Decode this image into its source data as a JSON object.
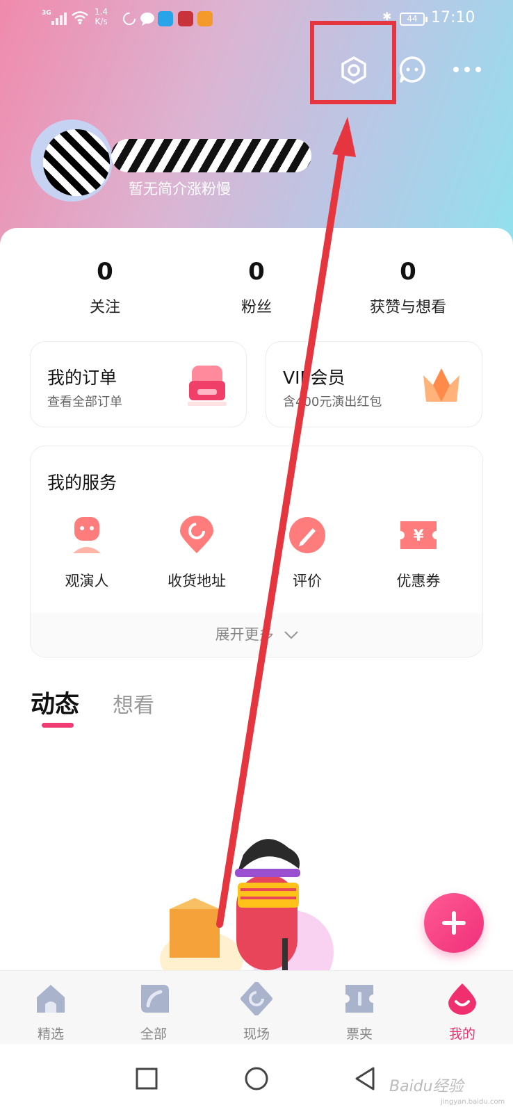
{
  "status_bar": {
    "network": "3G",
    "speed_line1": "1.4",
    "speed_line2": "K/s",
    "battery": "44",
    "time": "17:10"
  },
  "profile": {
    "bio": "暂无简介涨粉慢"
  },
  "stats": [
    {
      "value": "0",
      "label": "关注"
    },
    {
      "value": "0",
      "label": "粉丝"
    },
    {
      "value": "0",
      "label": "获赞与想看"
    }
  ],
  "quick_cards": {
    "orders": {
      "title": "我的订单",
      "subtitle": "查看全部订单"
    },
    "vip": {
      "title": "VIP会员",
      "subtitle": "含400元演出红包"
    }
  },
  "services": {
    "title": "我的服务",
    "items": [
      {
        "label": "观演人"
      },
      {
        "label": "收货地址"
      },
      {
        "label": "评价"
      },
      {
        "label": "优惠券"
      }
    ],
    "expand_label": "展开更多"
  },
  "tabs": {
    "active": "动态",
    "inactive": "想看"
  },
  "bottom_nav": [
    {
      "label": "精选"
    },
    {
      "label": "全部"
    },
    {
      "label": "现场"
    },
    {
      "label": "票夹"
    },
    {
      "label": "我的"
    }
  ],
  "watermark": {
    "main": "Baidu经验",
    "sub": "jingyan.baidu.com"
  },
  "colors": {
    "accent": "#f0306e",
    "annotation": "#e5353e"
  }
}
